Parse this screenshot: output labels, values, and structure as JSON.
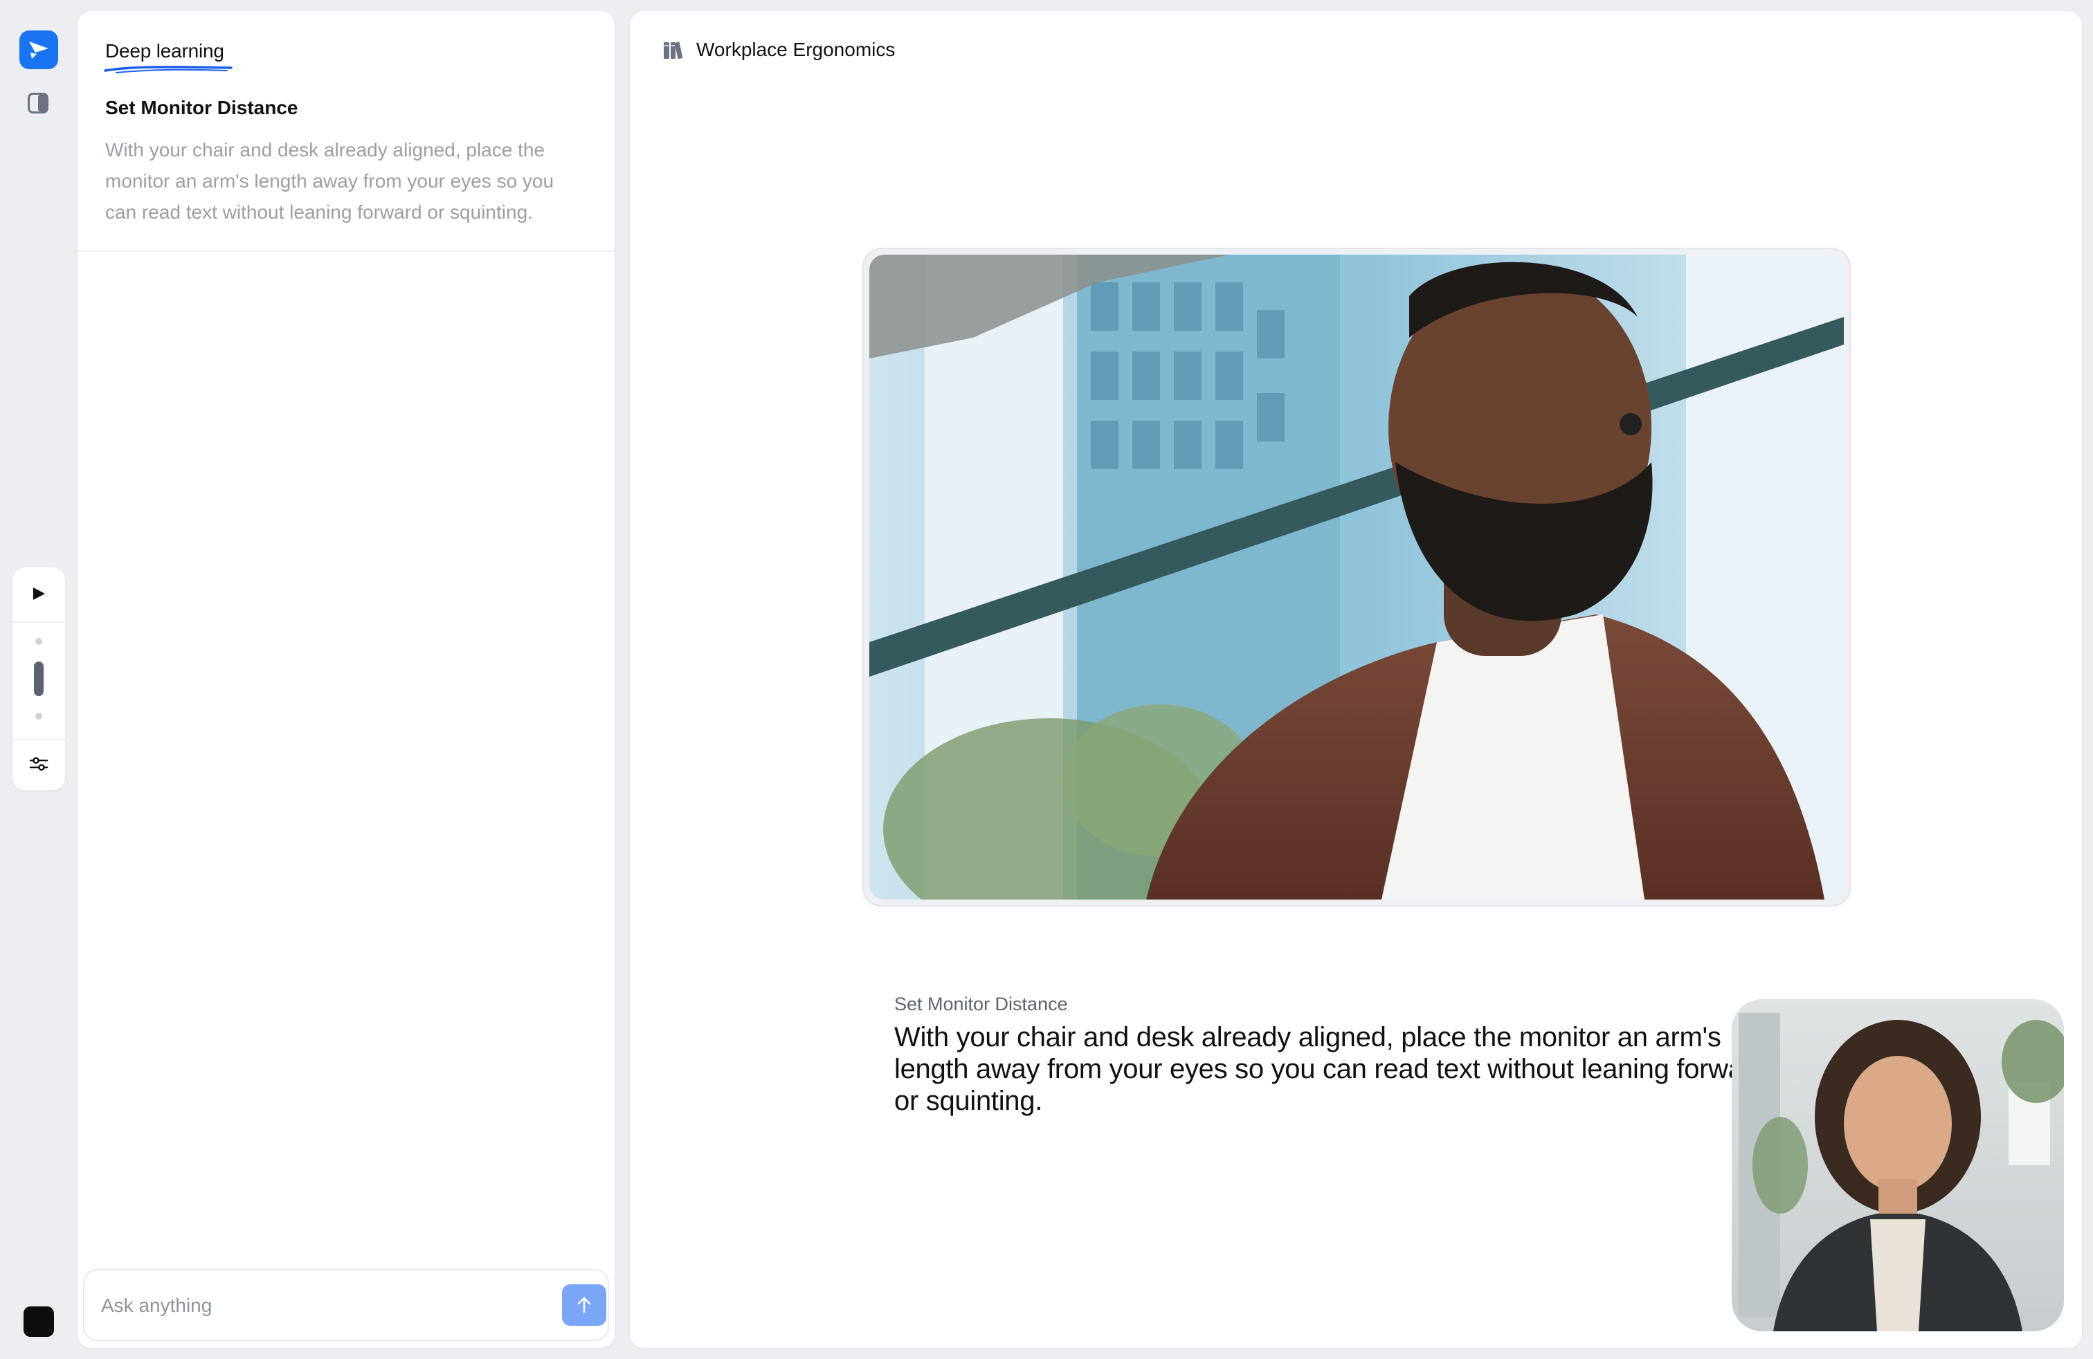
{
  "rail": {
    "logo_icon": "play-logo-icon",
    "panel_icon": "sidebar-toggle-icon",
    "player": {
      "play_icon": "play-icon",
      "settings_icon": "sliders-icon",
      "progress_level": 0.5
    },
    "avatar_color": "#0d0d10"
  },
  "sidebar": {
    "topic_tab": "Deep learning",
    "step": {
      "title": "Set Monitor Distance",
      "description": "With your chair and desk already aligned, place the monitor an arm's length away from your eyes so you can read text without leaning forward or squinting."
    },
    "ask": {
      "placeholder": "Ask anything",
      "send_icon": "arrow-up-icon"
    }
  },
  "main": {
    "course_icon": "books-icon",
    "course_title": "Workplace Ergonomics",
    "caption": {
      "label": "Set Monitor Distance",
      "text": "With your chair and desk already aligned, place the monitor an arm's length away from your eyes so you can read text without leaning forward or squinting."
    }
  },
  "colors": {
    "accent": "#1a73f0",
    "send_button": "#7aa7f5",
    "muted_text": "#9a9ea6",
    "background": "#eceef1"
  }
}
